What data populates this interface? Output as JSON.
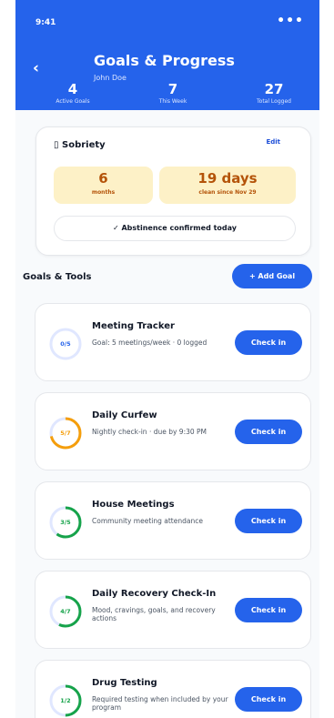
{
  "status_bar": {
    "time": "9:41",
    "menu": "•••"
  },
  "header": {
    "back": "‹",
    "title": "Goals & Progress",
    "subtitle": "John Doe",
    "stats": [
      {
        "value": "4",
        "label": "Active Goals"
      },
      {
        "value": "7",
        "label": "This Week"
      },
      {
        "value": "27",
        "label": "Total Logged"
      }
    ]
  },
  "sobriety": {
    "icon": "▯",
    "title": "Sobriety",
    "edit_label": "Edit",
    "months_value": "6",
    "months_label": "months",
    "days_value": "19 days",
    "days_label": "clean since Nov 29",
    "confirm_check": "✓",
    "confirm_text": "Abstinence confirmed today"
  },
  "section": {
    "title": "Goals & Tools",
    "add_label": "+ Add Goal"
  },
  "colors": {
    "accent": "#2563eb",
    "ring_track": "#e0e7ff",
    "ring_orange": "#f59e0b",
    "ring_green": "#16a34a",
    "ring_blue": "#2563eb"
  },
  "goals": [
    {
      "name": "Meeting Tracker",
      "desc": "Goal: 5 meetings/week · 0 logged",
      "progress": "0/5",
      "completed": 0,
      "target": 5,
      "color": "#2563eb",
      "checkin": "Check in"
    },
    {
      "name": "Daily Curfew",
      "desc": "Nightly check-in · due by 9:30 PM",
      "progress": "5/7",
      "completed": 5,
      "target": 7,
      "color": "#f59e0b",
      "checkin": "Check in"
    },
    {
      "name": "House Meetings",
      "desc": "Community meeting attendance",
      "progress": "3/5",
      "completed": 3,
      "target": 5,
      "color": "#16a34a",
      "checkin": "Check in"
    },
    {
      "name": "Daily Recovery Check-In",
      "desc": "Mood, cravings, goals, and recovery actions",
      "progress": "4/7",
      "completed": 4,
      "target": 7,
      "color": "#16a34a",
      "checkin": "Check in"
    },
    {
      "name": "Drug Testing",
      "desc": "Required testing when included by your program",
      "progress": "1/2",
      "completed": 1,
      "target": 2,
      "color": "#16a34a",
      "checkin": "Check in"
    }
  ]
}
